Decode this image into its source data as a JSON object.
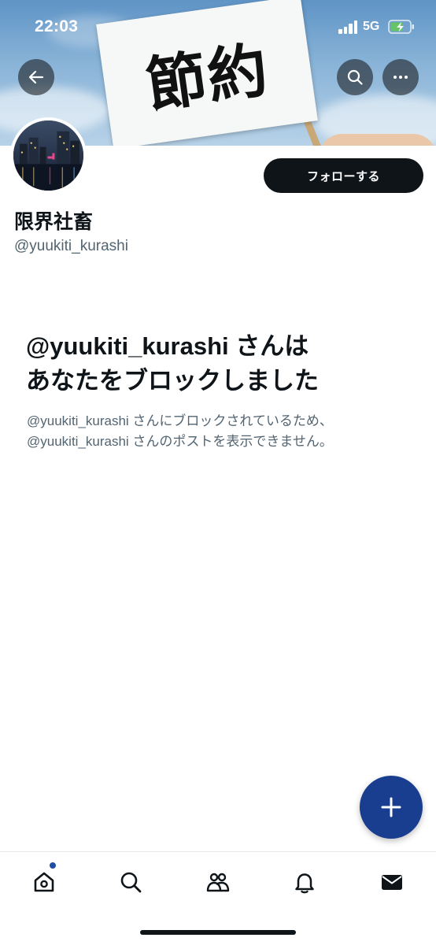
{
  "status_bar": {
    "time": "22:03",
    "network": "5G",
    "battery_state": "charging",
    "battery_color": "#65c466"
  },
  "banner": {
    "flag_text": "節約",
    "back_icon": "arrow-left-icon",
    "search_icon": "search-icon",
    "more_icon": "more-dots-icon"
  },
  "profile": {
    "display_name": "限界社畜",
    "handle": "@yuukiti_kurashi",
    "follow_label": "フォローする"
  },
  "blocked": {
    "title_line1": "@yuukiti_kurashi さんは",
    "title_line2": "あなたをブロックしました",
    "desc_line1": "@yuukiti_kurashi さんにブロックされているため、",
    "desc_line2": "@yuukiti_kurashi さんのポストを表示できません。"
  },
  "fab": {
    "icon": "plus-icon",
    "color": "#1a3e8f"
  },
  "tabbar": {
    "items": [
      {
        "id": "home",
        "icon": "home-icon",
        "has_badge": true
      },
      {
        "id": "search",
        "icon": "search-icon"
      },
      {
        "id": "communities",
        "icon": "communities-icon"
      },
      {
        "id": "notifications",
        "icon": "bell-icon"
      },
      {
        "id": "messages",
        "icon": "envelope-icon"
      }
    ],
    "badge_color": "#1d4fa6"
  },
  "colors": {
    "text_primary": "#0f1419",
    "text_secondary": "#536471",
    "button_dark": "#0f1419"
  }
}
